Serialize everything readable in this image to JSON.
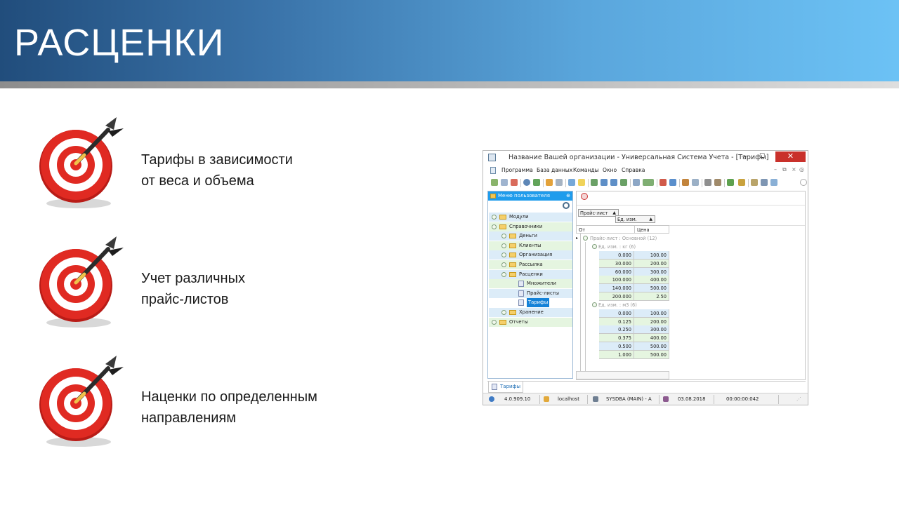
{
  "slide": {
    "title": "РАСЦЕНКИ"
  },
  "bullets": [
    {
      "icon": "dartboard-target-icon",
      "line1": "Тарифы в зависимости",
      "line2": "от веса и объема"
    },
    {
      "icon": "dartboard-target-icon",
      "line1": "Учет различных",
      "line2": "прайс-листов"
    },
    {
      "icon": "dartboard-target-icon",
      "line1": "Наценки по определенным",
      "line2": "направлениям"
    }
  ],
  "colors": {
    "header_dark": "#214d7c",
    "header_light": "#6cc2f5",
    "target_red": "#e02a22",
    "panel_blue": "#1f9cec",
    "close_red": "#c9312b"
  },
  "window": {
    "title": "Название Вашей организации - Универсальная Система Учета - [Тарифы]",
    "controls": {
      "minimize": "—",
      "maximize": "☐",
      "close": "✕"
    },
    "menu": [
      "Программа",
      "База данных",
      "Команды",
      "Окно",
      "Справка"
    ],
    "menu_controls": {
      "minimize": "–",
      "restore": "⧉",
      "close": "×"
    },
    "left_panel": {
      "header": "Меню пользователя",
      "pin": "⊕",
      "tree": [
        {
          "label": "Модули",
          "level": 0,
          "kind": "folder",
          "expanded": false
        },
        {
          "label": "Справочники",
          "level": 0,
          "kind": "folder",
          "expanded": true
        },
        {
          "label": "Деньги",
          "level": 1,
          "kind": "folder",
          "expanded": false
        },
        {
          "label": "Клиенты",
          "level": 1,
          "kind": "folder",
          "expanded": false
        },
        {
          "label": "Организация",
          "level": 1,
          "kind": "folder",
          "expanded": false
        },
        {
          "label": "Рассылка",
          "level": 1,
          "kind": "folder",
          "expanded": false
        },
        {
          "label": "Расценки",
          "level": 1,
          "kind": "folder",
          "expanded": true
        },
        {
          "label": "Множители",
          "level": 2,
          "kind": "doc"
        },
        {
          "label": "Прайс-листы",
          "level": 2,
          "kind": "doc"
        },
        {
          "label": "Тарифы",
          "level": 2,
          "kind": "doc",
          "selected": true
        },
        {
          "label": "Хранение",
          "level": 1,
          "kind": "folder",
          "expanded": false
        },
        {
          "label": "Отчеты",
          "level": 0,
          "kind": "folder",
          "expanded": false
        }
      ]
    },
    "grid": {
      "group_chips": [
        "Прайс-лист",
        "Ед. изм."
      ],
      "columns": [
        "От",
        "Цена"
      ],
      "top_group": "Прайс-лист : Основной (12)",
      "groups": [
        {
          "label": "Ед. изм. : кг (6)",
          "rows": [
            {
              "from": "0.000",
              "price": "100.00"
            },
            {
              "from": "30.000",
              "price": "200.00"
            },
            {
              "from": "60.000",
              "price": "300.00"
            },
            {
              "from": "100.000",
              "price": "400.00"
            },
            {
              "from": "140.000",
              "price": "500.00"
            },
            {
              "from": "200.000",
              "price": "2.50"
            }
          ]
        },
        {
          "label": "Ед. изм. : м3 (6)",
          "rows": [
            {
              "from": "0.000",
              "price": "100.00"
            },
            {
              "from": "0.125",
              "price": "200.00"
            },
            {
              "from": "0.250",
              "price": "300.00"
            },
            {
              "from": "0.375",
              "price": "400.00"
            },
            {
              "from": "0.500",
              "price": "500.00"
            },
            {
              "from": "1.000",
              "price": "500.00"
            }
          ]
        }
      ]
    },
    "tabs": [
      "Тарифы"
    ],
    "status": {
      "version": "4.0.909.10",
      "server": "localhost",
      "user": "SYSDBA (MAIN) - A",
      "date": "03.08.2018",
      "timer": "00:00:00:042"
    }
  }
}
